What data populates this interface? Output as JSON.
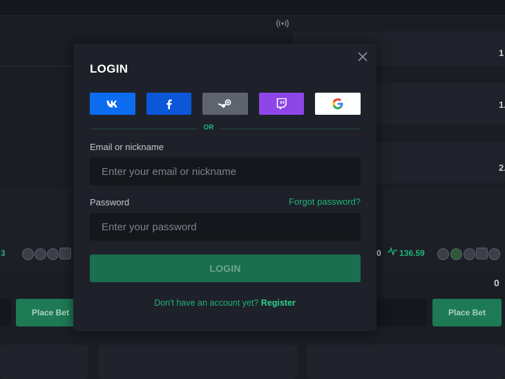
{
  "background": {
    "right_values": [
      "1",
      "1.",
      "2."
    ],
    "left_partial_value": "3",
    "right_partial_value": "136.59",
    "right_partial_prefix": "0",
    "right_bet_value": "0",
    "place_bet_label": "Place Bet"
  },
  "modal": {
    "title": "LOGIN",
    "close_icon": "close-icon",
    "social_buttons": [
      {
        "name": "vk",
        "icon": "vk-icon",
        "color": "#0b6cf0"
      },
      {
        "name": "facebook",
        "icon": "facebook-icon",
        "color": "#0b57d8"
      },
      {
        "name": "steam",
        "icon": "steam-icon",
        "color": "#5d646d"
      },
      {
        "name": "twitch",
        "icon": "twitch-icon",
        "color": "#8e46e9"
      },
      {
        "name": "google",
        "icon": "google-icon",
        "color": "#ffffff"
      }
    ],
    "divider_label": "OR",
    "email_label": "Email or nickname",
    "email_placeholder": "Enter your email or nickname",
    "password_label": "Password",
    "forgot_password": "Forgot password?",
    "password_placeholder": "Enter your password",
    "login_button": "LOGIN",
    "register_prompt": "Don't have an account yet?",
    "register_link": "Register"
  },
  "colors": {
    "accent": "#1fb37a",
    "modal_bg": "#1e2129",
    "page_bg": "#1a1d24"
  }
}
